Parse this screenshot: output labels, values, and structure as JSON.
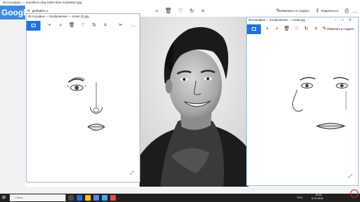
{
  "main": {
    "title": "Фотографии — marshilov-oleg-1994-skier-4c5d4624.jpg",
    "google": "Google",
    "add_label": "Добавить к",
    "edit_label": "Изменить и создать",
    "share_label": "Поделиться"
  },
  "left_window": {
    "title": "Фотографии — Изображение — копия (2).jpg"
  },
  "right_window": {
    "title": "Фотографии — Изображение — копия.jpg",
    "edit_label": "Изменить и создать"
  },
  "taskbar": {
    "search_placeholder": "Поиск",
    "time": "20:40",
    "date": "11.07.2019",
    "lang": "РУС"
  },
  "colors": {
    "accent": "#1a73e8",
    "taskbar": "#202020",
    "record": "#e02020"
  }
}
